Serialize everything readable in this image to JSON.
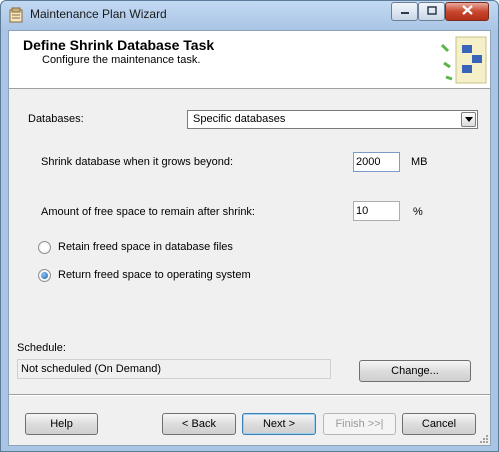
{
  "window": {
    "title": "Maintenance Plan Wizard"
  },
  "header": {
    "title": "Define Shrink Database Task",
    "subtitle": "Configure the maintenance task."
  },
  "databases": {
    "label": "Databases:",
    "selected": "Specific databases"
  },
  "shrink": {
    "grows_label": "Shrink database when it grows beyond:",
    "grows_value": "2000",
    "grows_unit": "MB",
    "free_label": "Amount of free space to remain after shrink:",
    "free_value": "10",
    "free_unit": "%"
  },
  "options": {
    "retain_label": "Retain freed space in database files",
    "return_label": "Return freed space to operating system",
    "selected": "return"
  },
  "schedule": {
    "label": "Schedule:",
    "value": "Not scheduled (On Demand)",
    "change_label": "Change..."
  },
  "buttons": {
    "help": "Help",
    "back": "< Back",
    "next": "Next >",
    "finish": "Finish >>|",
    "cancel": "Cancel"
  },
  "colors": {
    "title_bar": "#a9c4e4",
    "close_button": "#c8462e",
    "dialog_background": "#f0f0f0",
    "radio_selected": "#1b5fa8"
  },
  "icons": {
    "title": "wizard-app-icon",
    "header": "maintenance-plan-art-icon",
    "dropdown": "chevron-down-icon",
    "minimize": "minimize-icon",
    "maximize": "maximize-icon",
    "close": "close-icon"
  }
}
